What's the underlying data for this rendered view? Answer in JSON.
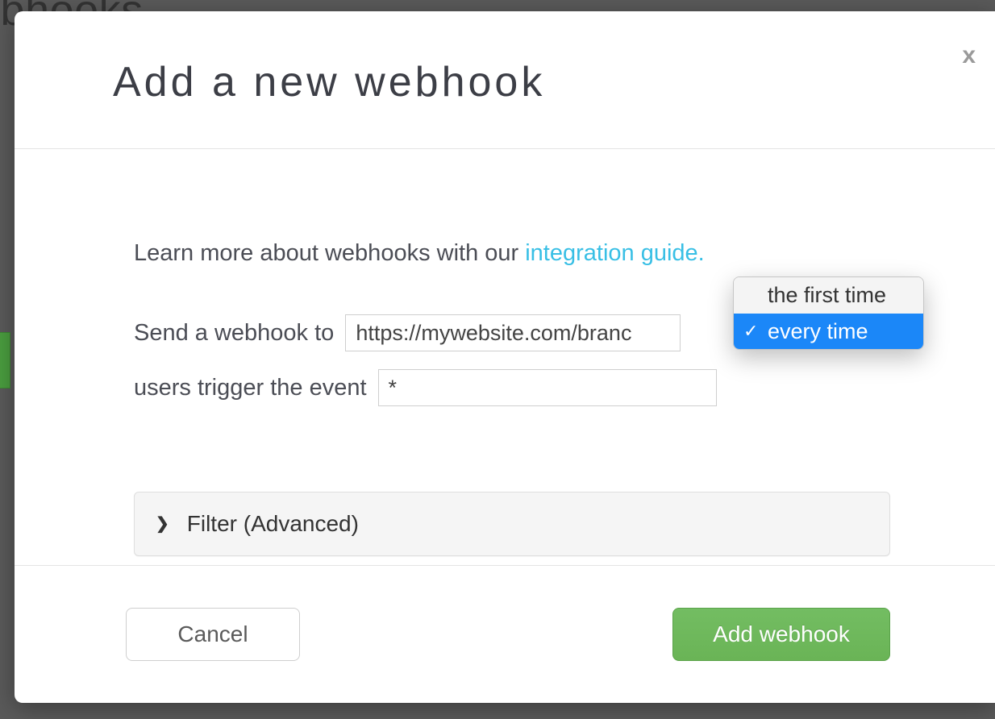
{
  "backdrop": {
    "page_title_fragment": "ebhooks"
  },
  "modal": {
    "title": "Add a new webhook",
    "close_label": "x",
    "intro_prefix": "Learn more about webhooks with our ",
    "intro_link": "integration guide.",
    "row1_label": "Send a webhook to",
    "url_value": "https://mywebsite.com/branc",
    "row2_label": "users trigger the event",
    "event_value": "*",
    "dropdown": {
      "options": [
        {
          "label": "the first time",
          "selected": false
        },
        {
          "label": "every time",
          "selected": true
        }
      ]
    },
    "filter_label": "Filter (Advanced)",
    "cancel_label": "Cancel",
    "submit_label": "Add webhook"
  }
}
